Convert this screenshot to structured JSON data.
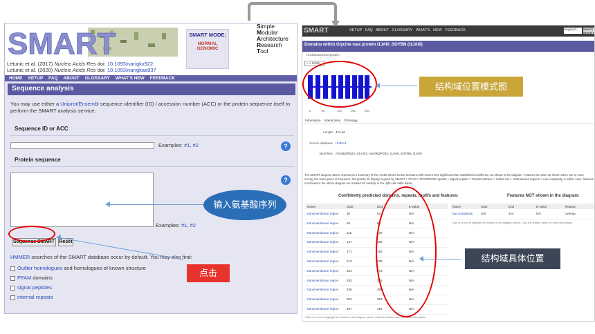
{
  "left_page": {
    "logo_text": "SMART",
    "citation_1_prefix": "Letunic et al. (2017) ",
    "citation_1_journal": "Nucleic Acids Res",
    "citation_1_doi_label": " doi: ",
    "citation_1_doi": "10.1093/nar/gkx922",
    "citation_2_prefix": "Letunic et al. (2020) ",
    "citation_2_journal": "Nucleic Acids Res",
    "citation_2_doi_label": " doi: ",
    "citation_2_doi": "10.1093/nar/gkaa937",
    "mode_title": "SMART MODE:",
    "mode_normal": "NORMAL",
    "mode_genomic": "GENOMIC",
    "acronym": [
      {
        "letter": "S",
        "rest": "imple"
      },
      {
        "letter": "M",
        "rest": "odular"
      },
      {
        "letter": "A",
        "rest": "rchitecture"
      },
      {
        "letter": "R",
        "rest": "esearch"
      },
      {
        "letter": "T",
        "rest": "ool"
      }
    ],
    "nav": [
      "HOME",
      "SETUP",
      "FAQ",
      "ABOUT",
      "GLOSSARY",
      "WHAT'S NEW",
      "FEEDBACK"
    ],
    "section_title": "Sequence analysis",
    "intro_part1": "You may use either a ",
    "intro_link": "Uniprot/Ensembl",
    "intro_part2": " sequence identifier (ID) / accession number (ACC) or the protein sequence itself to perform the SMART analysis service.",
    "seqid_heading": "Sequence ID or ACC",
    "examples_label": "Examples: ",
    "example1": "#1",
    "example2": "#2",
    "protein_heading": "Protein sequence",
    "submit_label": "Sequence SMART",
    "reset_label": "Reset",
    "hmmer_link": "HMMER",
    "hmmer_text": " searches of the SMART database occur by default. You may also find:",
    "options": [
      {
        "link": "Outlier homologues",
        "rest": " and homologues of known structure"
      },
      {
        "link": "PFAM",
        "rest": " domains"
      },
      {
        "link": "signal peptides",
        "rest": ""
      },
      {
        "link": "internal repeats",
        "rest": ""
      }
    ]
  },
  "right_page": {
    "logo": "SMART",
    "nav": "SETUP  FAQ  ABOUT  GLOSSARY  WHAT'S NEW  FEEDBACK",
    "search_value": "keyword...",
    "search_button": "Search SMART",
    "title": "Domains within Glycine max protein I1JAI0_SOYBN (I1JAI0)",
    "subtitle": "Uncharacterized protein",
    "tools": "« » SAVE",
    "diagram_ticks": [
      "0",
      "50",
      "100",
      "150",
      "200"
    ],
    "tabs": "Information  Interactions  Orthology",
    "info": [
      {
        "label": "Length",
        "value": "413 aa",
        "link": false
      },
      {
        "label": "Source database",
        "value": "UniProt",
        "link": true
      },
      {
        "label": "Identifiers",
        "value": "A0A0B2PDZ4_GLYSO, A0A0B2PDZ4, I1JAI0_SOYBN, I1JAI0",
        "link": false
      }
    ],
    "note": "The SMART diagram above represents a summary of the results shown below. Domains with scores less significant than established cutoffs are not shown in the diagram. Features are also not shown when two or more occupy the same piece of sequence; the priority for display is given by SMART > PFAM > PROSPERO repeats > Signal peptide > Transmembrane > Coiled coil > Unstructured regions > Low complexity. In either case, features not shown in the above diagram are marked as 'overlap' in the right side table below.",
    "table1_title": "Confidently predicted domains, repeats, motifs and features:",
    "table1_headers": [
      "Name",
      "Start",
      "End",
      "E-value"
    ],
    "table1_rows": [
      {
        "name": "transmembrane region",
        "start": "30",
        "end": "52",
        "e": "N/A"
      },
      {
        "name": "transmembrane region",
        "start": "65",
        "end": "85",
        "e": "N/A"
      },
      {
        "name": "transmembrane region",
        "start": "115",
        "end": "137",
        "e": "N/A"
      },
      {
        "name": "transmembrane region",
        "start": "147",
        "end": "169",
        "e": "N/A"
      },
      {
        "name": "transmembrane region",
        "start": "171",
        "end": "193",
        "e": "N/A"
      },
      {
        "name": "transmembrane region",
        "start": "213",
        "end": "235",
        "e": "N/A"
      },
      {
        "name": "transmembrane region",
        "start": "251",
        "end": "273",
        "e": "N/A"
      },
      {
        "name": "transmembrane region",
        "start": "293",
        "end": "315",
        "e": "N/A"
      },
      {
        "name": "transmembrane region",
        "start": "336",
        "end": "358",
        "e": "N/A"
      },
      {
        "name": "transmembrane region",
        "start": "362",
        "end": "384",
        "e": "N/A"
      },
      {
        "name": "transmembrane region",
        "start": "397",
        "end": "419",
        "e": "N/A"
      }
    ],
    "table2_title": "Features NOT shown in the diagram:",
    "table2_headers": [
      "Name",
      "Start",
      "End",
      "E-value",
      "Reason"
    ],
    "table2_rows": [
      {
        "name": "low complexity",
        "start": "405",
        "end": "424",
        "e": "N/A",
        "reason": "overlap"
      }
    ],
    "table2_note": "Click on a row to highlight the feature in the diagram above. Click the feature name for more information.",
    "table1_note": "Click on a row to highlight the feature in the diagram above. Click the feature name for more information."
  },
  "annotations": {
    "input_seq": "输入氨基酸序列",
    "click": "点击",
    "domain_pattern": "结构域位置模式图",
    "domain_positions": "结构域具体位置"
  },
  "colors": {
    "smart_purple": "#5a5aa3",
    "callout_blue": "#2a6eb8",
    "callout_gold": "#c9a53a",
    "callout_red": "#e8322c",
    "callout_dark": "#3c4656",
    "domain_blue": "#1414d0"
  }
}
